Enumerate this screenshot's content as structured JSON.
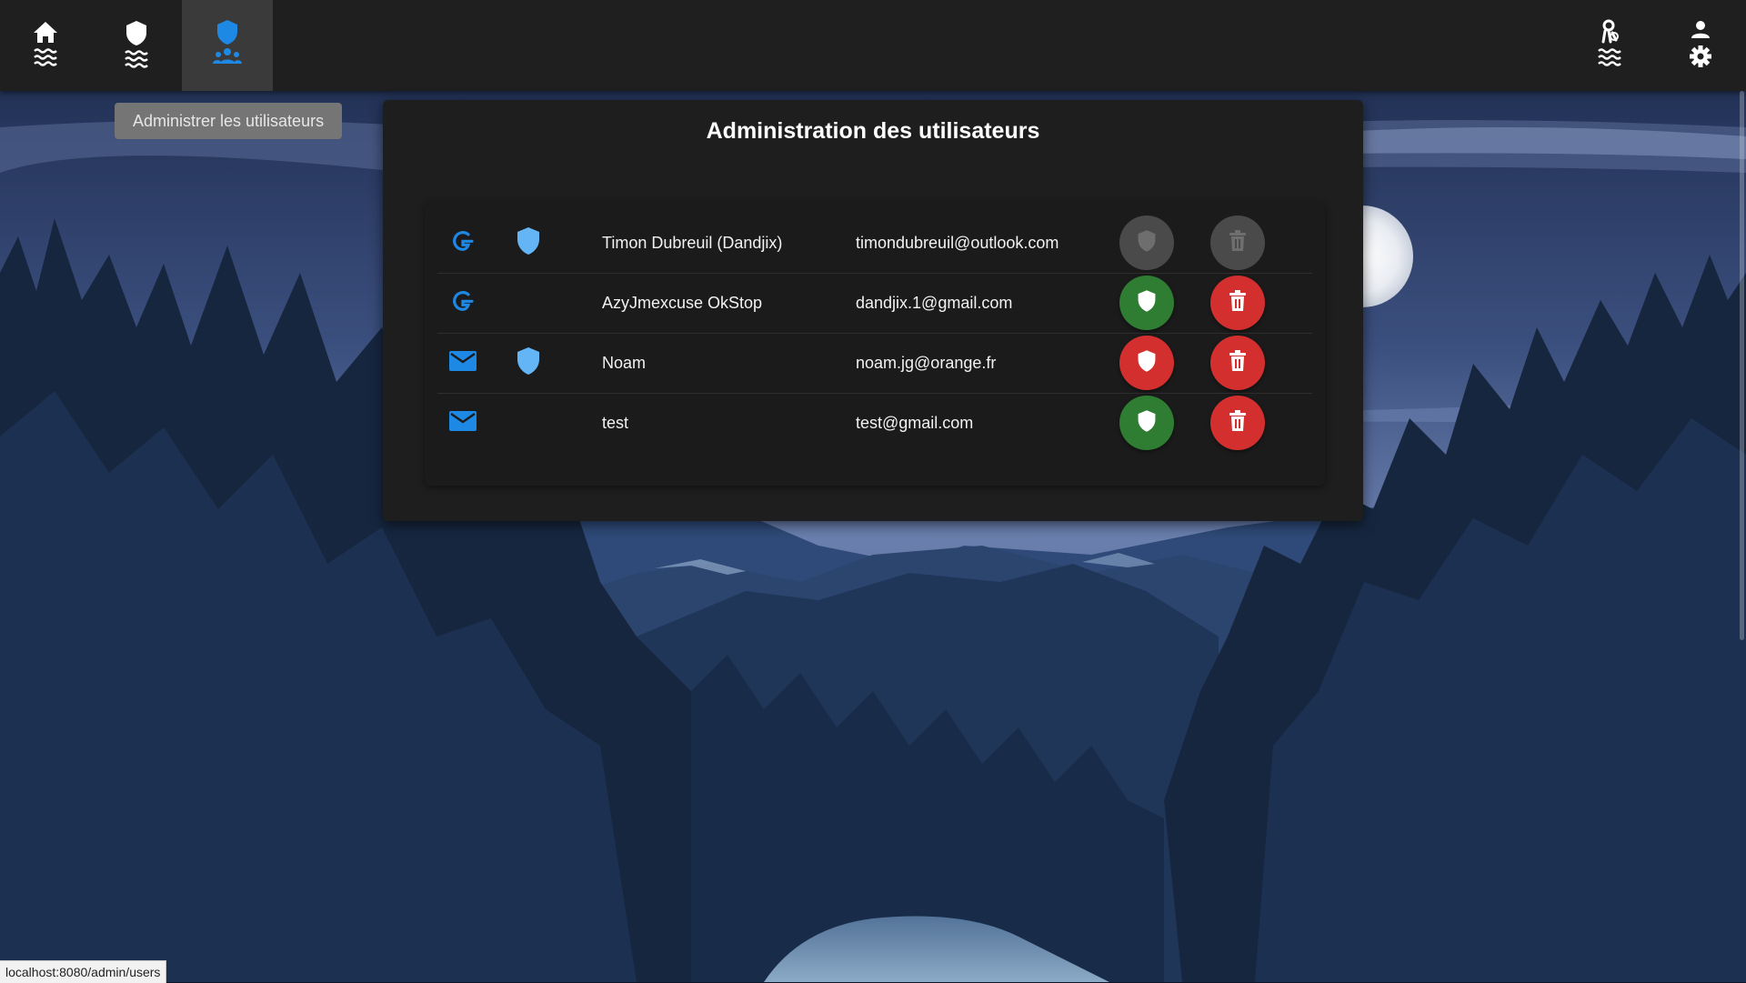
{
  "nav": {
    "left": [
      {
        "name": "home",
        "icon": "home-waves-icon"
      },
      {
        "name": "admin-shield",
        "icon": "shield-waves-icon"
      },
      {
        "name": "admin-users",
        "icon": "shield-users-icon",
        "active": true
      }
    ],
    "right": [
      {
        "name": "lifeguard",
        "icon": "lifeguard-waves-icon"
      },
      {
        "name": "account-settings",
        "icon": "user-gear-icon"
      }
    ]
  },
  "tooltip": {
    "text": "Administrer les utilisateurs"
  },
  "panel": {
    "title": "Administration des utilisateurs",
    "users": [
      {
        "provider": "google-icon",
        "is_admin": true,
        "name": "Timon Dubreuil (Dandjix)",
        "email": "timondubreuil@outlook.com",
        "toggle_state": "disabled",
        "delete_state": "disabled"
      },
      {
        "provider": "google-icon",
        "is_admin": false,
        "name": "AzyJmexcuse OkStop",
        "email": "dandjix.1@gmail.com",
        "toggle_state": "grant",
        "delete_state": "enabled"
      },
      {
        "provider": "mail-icon",
        "is_admin": true,
        "name": "Noam",
        "email": "noam.jg@orange.fr",
        "toggle_state": "revoke",
        "delete_state": "enabled"
      },
      {
        "provider": "mail-icon",
        "is_admin": false,
        "name": "test",
        "email": "test@gmail.com",
        "toggle_state": "grant",
        "delete_state": "enabled"
      }
    ]
  },
  "colors": {
    "accent": "#1e88e5",
    "admin_shield": "#64b5f6",
    "grant": "#2e7d32",
    "revoke": "#d32f2f",
    "delete": "#d32f2f",
    "disabled": "#4a4a4a"
  },
  "status_bar": {
    "url": "localhost:8080/admin/users"
  }
}
